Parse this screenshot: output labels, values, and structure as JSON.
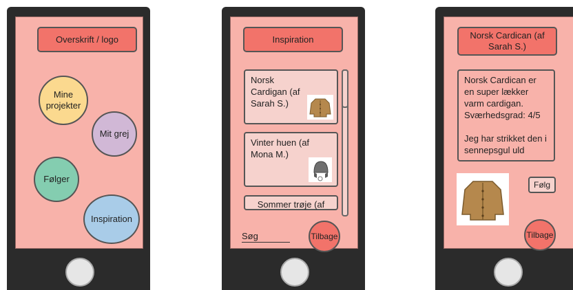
{
  "screen1": {
    "header": "Overskrift / logo",
    "circles": [
      {
        "label": "Mine projekter",
        "color": "#fbd98f"
      },
      {
        "label": "Mit grej",
        "color": "#d1b8d6"
      },
      {
        "label": "Følger",
        "color": "#84cdb0"
      },
      {
        "label": "Inspiration",
        "color": "#a9cce8"
      }
    ]
  },
  "screen2": {
    "header": "Inspiration",
    "cards": [
      {
        "title": "Norsk Cardigan (af Sarah S.)",
        "image_icon": "cardigan-icon"
      },
      {
        "title": "Vinter huen (af Mona M.)",
        "image_icon": "beanie-icon"
      },
      {
        "title": "Sommer trøje (af"
      }
    ],
    "search_label": "Søg",
    "back_label": "Tilbage"
  },
  "screen3": {
    "header": "Norsk Cardican (af Sarah S.)",
    "description": "Norsk Cardican er en super lækker varm cardigan. Sværhedsgrad: 4/5",
    "description2": "Jeg har strikket den i sennepsgul uld",
    "follow_label": "Følg",
    "back_label": "Tilbage",
    "image_icon": "cardigan-icon"
  },
  "colors": {
    "phone": "#2b2b2b",
    "screen": "#f8b2aa",
    "accent": "#f2736a",
    "card": "#f6d2cd"
  }
}
